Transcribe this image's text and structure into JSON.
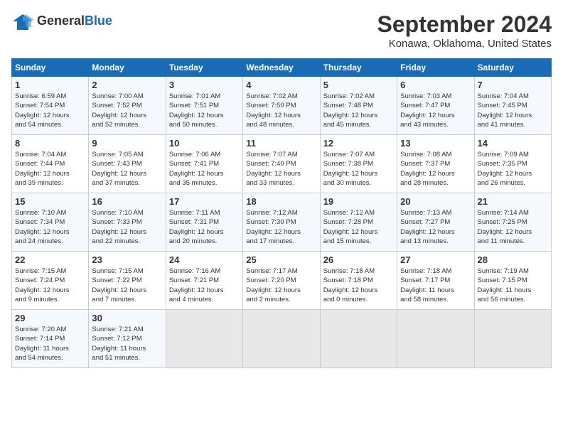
{
  "logo": {
    "general": "General",
    "blue": "Blue"
  },
  "title": "September 2024",
  "location": "Konawa, Oklahoma, United States",
  "days_header": [
    "Sunday",
    "Monday",
    "Tuesday",
    "Wednesday",
    "Thursday",
    "Friday",
    "Saturday"
  ],
  "weeks": [
    [
      {
        "day": "1",
        "lines": [
          "Sunrise: 6:59 AM",
          "Sunset: 7:54 PM",
          "Daylight: 12 hours",
          "and 54 minutes."
        ]
      },
      {
        "day": "2",
        "lines": [
          "Sunrise: 7:00 AM",
          "Sunset: 7:52 PM",
          "Daylight: 12 hours",
          "and 52 minutes."
        ]
      },
      {
        "day": "3",
        "lines": [
          "Sunrise: 7:01 AM",
          "Sunset: 7:51 PM",
          "Daylight: 12 hours",
          "and 50 minutes."
        ]
      },
      {
        "day": "4",
        "lines": [
          "Sunrise: 7:02 AM",
          "Sunset: 7:50 PM",
          "Daylight: 12 hours",
          "and 48 minutes."
        ]
      },
      {
        "day": "5",
        "lines": [
          "Sunrise: 7:02 AM",
          "Sunset: 7:48 PM",
          "Daylight: 12 hours",
          "and 45 minutes."
        ]
      },
      {
        "day": "6",
        "lines": [
          "Sunrise: 7:03 AM",
          "Sunset: 7:47 PM",
          "Daylight: 12 hours",
          "and 43 minutes."
        ]
      },
      {
        "day": "7",
        "lines": [
          "Sunrise: 7:04 AM",
          "Sunset: 7:45 PM",
          "Daylight: 12 hours",
          "and 41 minutes."
        ]
      }
    ],
    [
      {
        "day": "8",
        "lines": [
          "Sunrise: 7:04 AM",
          "Sunset: 7:44 PM",
          "Daylight: 12 hours",
          "and 39 minutes."
        ]
      },
      {
        "day": "9",
        "lines": [
          "Sunrise: 7:05 AM",
          "Sunset: 7:43 PM",
          "Daylight: 12 hours",
          "and 37 minutes."
        ]
      },
      {
        "day": "10",
        "lines": [
          "Sunrise: 7:06 AM",
          "Sunset: 7:41 PM",
          "Daylight: 12 hours",
          "and 35 minutes."
        ]
      },
      {
        "day": "11",
        "lines": [
          "Sunrise: 7:07 AM",
          "Sunset: 7:40 PM",
          "Daylight: 12 hours",
          "and 33 minutes."
        ]
      },
      {
        "day": "12",
        "lines": [
          "Sunrise: 7:07 AM",
          "Sunset: 7:38 PM",
          "Daylight: 12 hours",
          "and 30 minutes."
        ]
      },
      {
        "day": "13",
        "lines": [
          "Sunrise: 7:08 AM",
          "Sunset: 7:37 PM",
          "Daylight: 12 hours",
          "and 28 minutes."
        ]
      },
      {
        "day": "14",
        "lines": [
          "Sunrise: 7:09 AM",
          "Sunset: 7:35 PM",
          "Daylight: 12 hours",
          "and 26 minutes."
        ]
      }
    ],
    [
      {
        "day": "15",
        "lines": [
          "Sunrise: 7:10 AM",
          "Sunset: 7:34 PM",
          "Daylight: 12 hours",
          "and 24 minutes."
        ]
      },
      {
        "day": "16",
        "lines": [
          "Sunrise: 7:10 AM",
          "Sunset: 7:33 PM",
          "Daylight: 12 hours",
          "and 22 minutes."
        ]
      },
      {
        "day": "17",
        "lines": [
          "Sunrise: 7:11 AM",
          "Sunset: 7:31 PM",
          "Daylight: 12 hours",
          "and 20 minutes."
        ]
      },
      {
        "day": "18",
        "lines": [
          "Sunrise: 7:12 AM",
          "Sunset: 7:30 PM",
          "Daylight: 12 hours",
          "and 17 minutes."
        ]
      },
      {
        "day": "19",
        "lines": [
          "Sunrise: 7:12 AM",
          "Sunset: 7:28 PM",
          "Daylight: 12 hours",
          "and 15 minutes."
        ]
      },
      {
        "day": "20",
        "lines": [
          "Sunrise: 7:13 AM",
          "Sunset: 7:27 PM",
          "Daylight: 12 hours",
          "and 13 minutes."
        ]
      },
      {
        "day": "21",
        "lines": [
          "Sunrise: 7:14 AM",
          "Sunset: 7:25 PM",
          "Daylight: 12 hours",
          "and 11 minutes."
        ]
      }
    ],
    [
      {
        "day": "22",
        "lines": [
          "Sunrise: 7:15 AM",
          "Sunset: 7:24 PM",
          "Daylight: 12 hours",
          "and 9 minutes."
        ]
      },
      {
        "day": "23",
        "lines": [
          "Sunrise: 7:15 AM",
          "Sunset: 7:22 PM",
          "Daylight: 12 hours",
          "and 7 minutes."
        ]
      },
      {
        "day": "24",
        "lines": [
          "Sunrise: 7:16 AM",
          "Sunset: 7:21 PM",
          "Daylight: 12 hours",
          "and 4 minutes."
        ]
      },
      {
        "day": "25",
        "lines": [
          "Sunrise: 7:17 AM",
          "Sunset: 7:20 PM",
          "Daylight: 12 hours",
          "and 2 minutes."
        ]
      },
      {
        "day": "26",
        "lines": [
          "Sunrise: 7:18 AM",
          "Sunset: 7:18 PM",
          "Daylight: 12 hours",
          "and 0 minutes."
        ]
      },
      {
        "day": "27",
        "lines": [
          "Sunrise: 7:18 AM",
          "Sunset: 7:17 PM",
          "Daylight: 11 hours",
          "and 58 minutes."
        ]
      },
      {
        "day": "28",
        "lines": [
          "Sunrise: 7:19 AM",
          "Sunset: 7:15 PM",
          "Daylight: 11 hours",
          "and 56 minutes."
        ]
      }
    ],
    [
      {
        "day": "29",
        "lines": [
          "Sunrise: 7:20 AM",
          "Sunset: 7:14 PM",
          "Daylight: 11 hours",
          "and 54 minutes."
        ]
      },
      {
        "day": "30",
        "lines": [
          "Sunrise: 7:21 AM",
          "Sunset: 7:12 PM",
          "Daylight: 11 hours",
          "and 51 minutes."
        ]
      },
      {
        "day": "",
        "lines": []
      },
      {
        "day": "",
        "lines": []
      },
      {
        "day": "",
        "lines": []
      },
      {
        "day": "",
        "lines": []
      },
      {
        "day": "",
        "lines": []
      }
    ]
  ]
}
